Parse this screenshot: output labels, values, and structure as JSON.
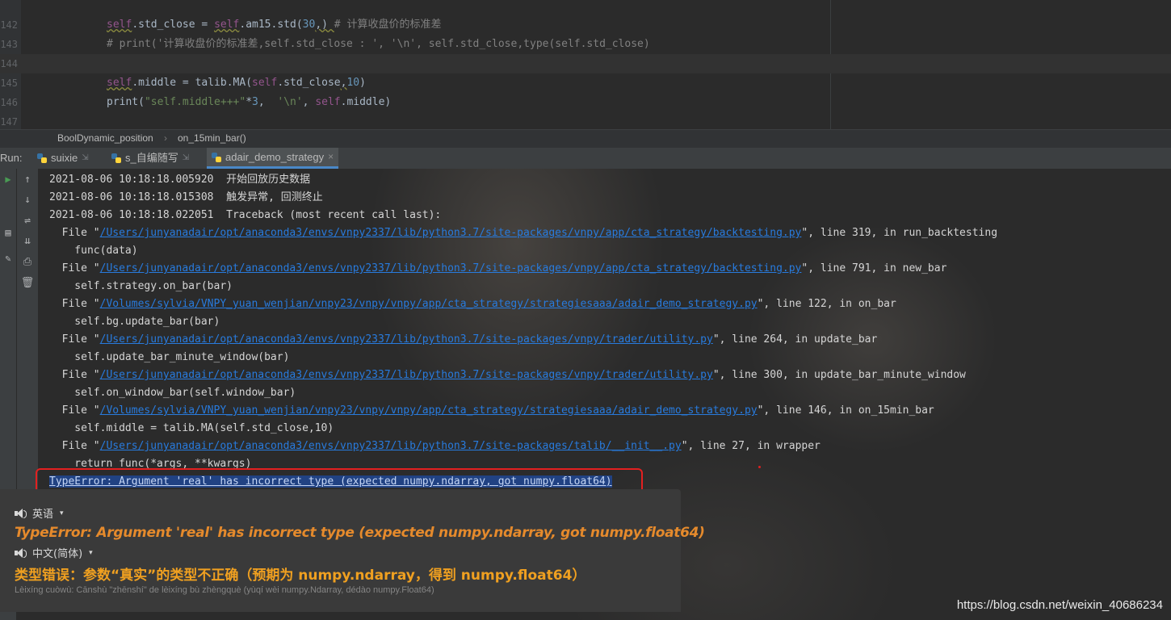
{
  "editor": {
    "lines": [
      {
        "num": "142",
        "parts": [
          {
            "t": "self",
            "c": "kw-self underline"
          },
          {
            "t": ".std_close = ",
            "c": "fn"
          },
          {
            "t": "self",
            "c": "kw-self underline"
          },
          {
            "t": ".am15.std(",
            "c": "fn"
          },
          {
            "t": "30",
            "c": "num"
          },
          {
            "t": ",) ",
            "c": "fn underline"
          },
          {
            "t": "# 计算收盘价的标准差",
            "c": "cmt"
          }
        ]
      },
      {
        "num": "143",
        "parts": [
          {
            "t": "# print('计算收盘价的标准差,self.std_close : ', '\\n', self.std_close,type(self.std_close)",
            "c": "cmt"
          }
        ]
      },
      {
        "num": "144",
        "parts": [],
        "active": true
      },
      {
        "num": "145",
        "parts": [
          {
            "t": "self",
            "c": "kw-self underline"
          },
          {
            "t": ".middle = talib.MA(",
            "c": "fn"
          },
          {
            "t": "self",
            "c": "kw-self"
          },
          {
            "t": ".std_close",
            "c": "fn"
          },
          {
            "t": ",",
            "c": "fn underline"
          },
          {
            "t": "10",
            "c": "num"
          },
          {
            "t": ")",
            "c": "fn"
          }
        ]
      },
      {
        "num": "146",
        "parts": [
          {
            "t": "print(",
            "c": "fn"
          },
          {
            "t": "\"self.middle+++\"",
            "c": "str"
          },
          {
            "t": "*",
            "c": "fn"
          },
          {
            "t": "3",
            "c": "num"
          },
          {
            "t": ",  ",
            "c": "fn"
          },
          {
            "t": "'\\n'",
            "c": "str"
          },
          {
            "t": ", ",
            "c": "fn"
          },
          {
            "t": "self",
            "c": "kw-self"
          },
          {
            "t": ".middle)",
            "c": "fn"
          }
        ]
      },
      {
        "num": "147",
        "parts": []
      }
    ]
  },
  "breadcrumb": {
    "class_name": "BoolDynamic_position",
    "method_name": "on_15min_bar()"
  },
  "run": {
    "label": "Run:",
    "tabs": [
      {
        "label": "suixie",
        "pin": "⇲",
        "active": false
      },
      {
        "label": "s_自编随写",
        "pin": "⇲",
        "active": false
      },
      {
        "label": "adair_demo_strategy",
        "pin": "×",
        "active": true
      }
    ]
  },
  "console": {
    "lines": [
      {
        "parts": [
          {
            "t": "2021-08-06 10:18:18.005920  开始回放历史数据"
          }
        ]
      },
      {
        "parts": [
          {
            "t": "2021-08-06 10:18:18.015308  触发异常, 回测终止"
          }
        ]
      },
      {
        "parts": [
          {
            "t": "2021-08-06 10:18:18.022051  Traceback (most recent call last):"
          }
        ]
      },
      {
        "parts": [
          {
            "t": "  File \""
          },
          {
            "t": "/Users/junyanadair/opt/anaconda3/envs/vnpy2337/lib/python3.7/site-packages/vnpy/app/cta_strategy/backtesting.py",
            "link": true
          },
          {
            "t": "\", line 319, in run_backtesting"
          }
        ]
      },
      {
        "parts": [
          {
            "t": "    func(data)"
          }
        ]
      },
      {
        "parts": [
          {
            "t": "  File \""
          },
          {
            "t": "/Users/junyanadair/opt/anaconda3/envs/vnpy2337/lib/python3.7/site-packages/vnpy/app/cta_strategy/backtesting.py",
            "link": true
          },
          {
            "t": "\", line 791, in new_bar"
          }
        ]
      },
      {
        "parts": [
          {
            "t": "    self.strategy.on_bar(bar)"
          }
        ]
      },
      {
        "parts": [
          {
            "t": "  File \""
          },
          {
            "t": "/Volumes/sylvia/VNPY_yuan_wenjian/vnpy23/vnpy/vnpy/app/cta_strategy/strategiesaaa/adair_demo_strategy.py",
            "link": true
          },
          {
            "t": "\", line 122, in on_bar"
          }
        ]
      },
      {
        "parts": [
          {
            "t": "    self.bg.update_bar(bar)"
          }
        ]
      },
      {
        "parts": [
          {
            "t": "  File \""
          },
          {
            "t": "/Users/junyanadair/opt/anaconda3/envs/vnpy2337/lib/python3.7/site-packages/vnpy/trader/utility.py",
            "link": true
          },
          {
            "t": "\", line 264, in update_bar"
          }
        ]
      },
      {
        "parts": [
          {
            "t": "    self.update_bar_minute_window(bar)"
          }
        ]
      },
      {
        "parts": [
          {
            "t": "  File \""
          },
          {
            "t": "/Users/junyanadair/opt/anaconda3/envs/vnpy2337/lib/python3.7/site-packages/vnpy/trader/utility.py",
            "link": true
          },
          {
            "t": "\", line 300, in update_bar_minute_window"
          }
        ]
      },
      {
        "parts": [
          {
            "t": "    self.on_window_bar(self.window_bar)"
          }
        ]
      },
      {
        "parts": [
          {
            "t": "  File \""
          },
          {
            "t": "/Volumes/sylvia/VNPY_yuan_wenjian/vnpy23/vnpy/vnpy/app/cta_strategy/strategiesaaa/adair_demo_strategy.py",
            "link": true
          },
          {
            "t": "\", line 146, in on_15min_bar"
          }
        ]
      },
      {
        "parts": [
          {
            "t": "    self.middle = talib.MA(self.std_close,10)"
          }
        ]
      },
      {
        "parts": [
          {
            "t": "  File \""
          },
          {
            "t": "/Users/junyanadair/opt/anaconda3/envs/vnpy2337/lib/python3.7/site-packages/talib/__init__.py",
            "link": true
          },
          {
            "t": "\", line 27, in wrapper"
          }
        ]
      },
      {
        "parts": [
          {
            "t": "    return func(*args, **kwargs)"
          }
        ]
      }
    ],
    "error_line": "TypeError: Argument 'real' has incorrect type (expected numpy.ndarray, got numpy.float64)"
  },
  "translation": {
    "source_lang": "英语",
    "source_text": "TypeError: Argument 'real' has incorrect type (expected numpy.ndarray, got numpy.float64)",
    "target_lang": "中文(简体)",
    "target_text": "类型错误：参数“真实”的类型不正确（预期为 numpy.ndarray，得到 numpy.float64）",
    "pinyin": "Lèixíng cuòwù: Cānshù \"zhēnshí\" de lèixíng bù zhèngquè (yùqí wèi numpy.Ndarray, dédào numpy.Float64)"
  },
  "watermark": "https://blog.csdn.net/weixin_40686234",
  "colors": {
    "accent": "#4a88c7",
    "error_box": "#e32020",
    "translation_text": "#e58a2c",
    "link": "#287bde"
  }
}
